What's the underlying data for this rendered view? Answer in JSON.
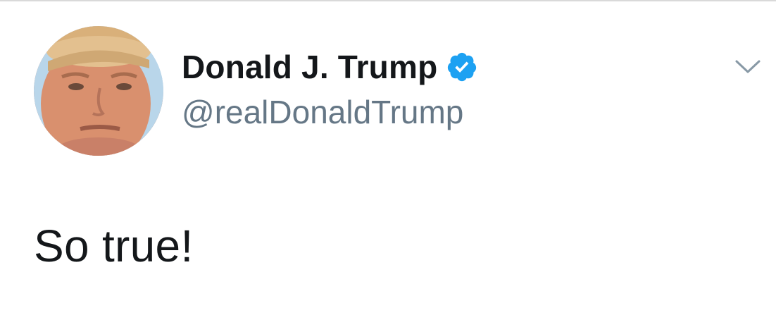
{
  "tweet": {
    "author": {
      "display_name": "Donald J. Trump",
      "handle": "@realDonaldTrump",
      "verified": true,
      "verified_icon": "verified-badge-icon",
      "avatar_icon": "profile-avatar"
    },
    "text": "So true!",
    "menu_icon": "chevron-down-icon"
  },
  "colors": {
    "name": "#14171a",
    "handle": "#657786",
    "verified_blue": "#1da1f2",
    "caret": "#8899a6",
    "border": "#d9d9d9"
  }
}
